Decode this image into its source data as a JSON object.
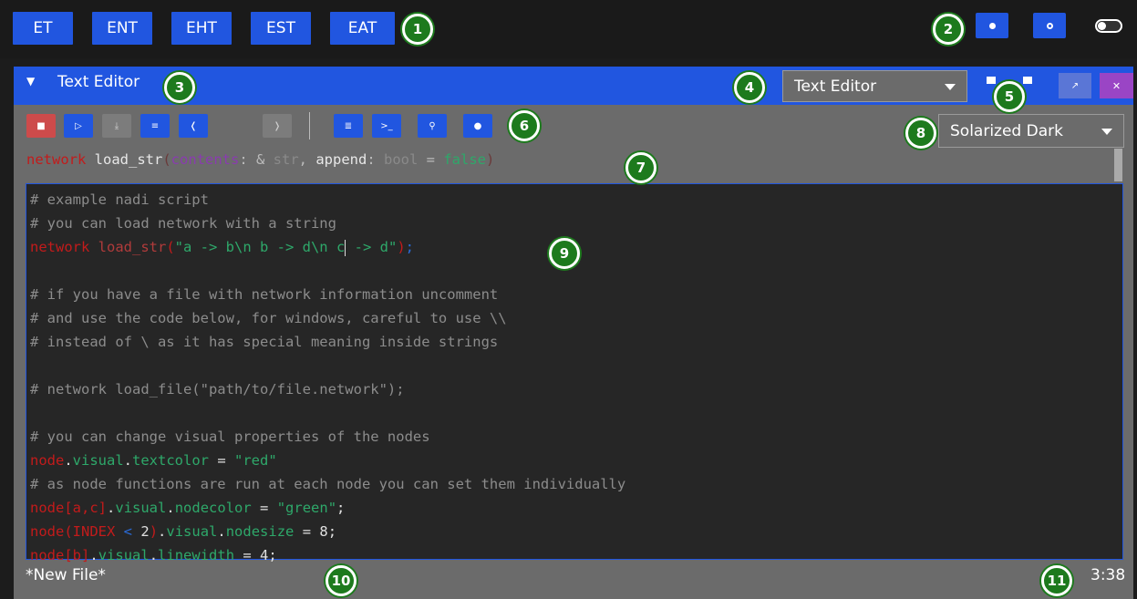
{
  "topbar": {
    "tabs": [
      "ET",
      "ENT",
      "EHT",
      "EST",
      "EAT"
    ]
  },
  "editor_window": {
    "title": "Text Editor",
    "pin_icon": "pin-icon",
    "editor_select": "Text Editor",
    "theme_select": "Solarized Dark",
    "toolbar_icons": [
      "delete-icon",
      "open-icon",
      "download-icon",
      "save-icon",
      "undo-icon",
      "redo-icon",
      "run-script-icon",
      "terminal-icon",
      "search-icon",
      "info-icon"
    ]
  },
  "signature": {
    "keyword": "network",
    "name": "load_str",
    "open": "(",
    "arg1": "contents",
    "colon1": ": & ",
    "type1": "str",
    "comma": ", ",
    "arg2": "append",
    "colon2": ": ",
    "type2": "bool",
    "eq": " = ",
    "default": "false",
    "close": ")"
  },
  "code_lines": {
    "l1": "# example nadi script",
    "l2": "# you can load network with a string",
    "l3_kw": "network",
    "l3_fn": " load_str",
    "l3_open": "(",
    "l3_str_a": "\"a -> b\\n b -> d\\n c",
    "l3_str_b": " -> d\"",
    "l3_close": ")",
    "l3_end": ";",
    "l5": "# if you have a file with network information uncomment",
    "l6": "# and use the code below, for windows, careful to use \\\\",
    "l7": "# instead of \\ as it has special meaning inside strings",
    "l9": "# network load_file(\"path/to/file.network\");",
    "l11": "# you can change visual properties of the nodes",
    "l12_kw": "node",
    "l12_a": ".",
    "l12_b": "visual",
    "l12_c": ".",
    "l12_d": "textcolor",
    "l12_e": " = ",
    "l12_f": "\"red\"",
    "l13": "# as node functions are run at each node you can set them individually",
    "l14_kw": "node",
    "l14_b1": "[",
    "l14_args": "a,c",
    "l14_b2": "]",
    "l14_rest1": ".",
    "l14_rest2": "visual",
    "l14_rest3": ".",
    "l14_rest4": "nodecolor",
    "l14_rest5": " = ",
    "l14_val": "\"green\"",
    "l14_end": ";",
    "l15_kw": "node",
    "l15_b1": "(",
    "l15_arg": "INDEX",
    "l15_op": " < ",
    "l15_num": "2",
    "l15_b2": ")",
    "l15_r1": ".",
    "l15_r2": "visual",
    "l15_r3": ".",
    "l15_r4": "nodesize",
    "l15_r5": " = ",
    "l15_val": "8",
    "l15_end": ";",
    "l16_kw": "node",
    "l16_b1": "[",
    "l16_arg": "b",
    "l16_b2": "]",
    "l16_r1": ".",
    "l16_r2": "visual",
    "l16_r3": ".",
    "l16_r4": "linewidth",
    "l16_r5": " = ",
    "l16_val": "4",
    "l16_end": ";"
  },
  "status": {
    "filename": "*New File*",
    "cursor_pos": "3:38"
  },
  "markers": [
    "1",
    "2",
    "3",
    "4",
    "5",
    "6",
    "7",
    "8",
    "9",
    "10",
    "11"
  ],
  "colors": {
    "accent": "#2156e0",
    "danger": "#cd4b4b",
    "marker": "#1d7a1d",
    "close": "#9a45c5"
  }
}
